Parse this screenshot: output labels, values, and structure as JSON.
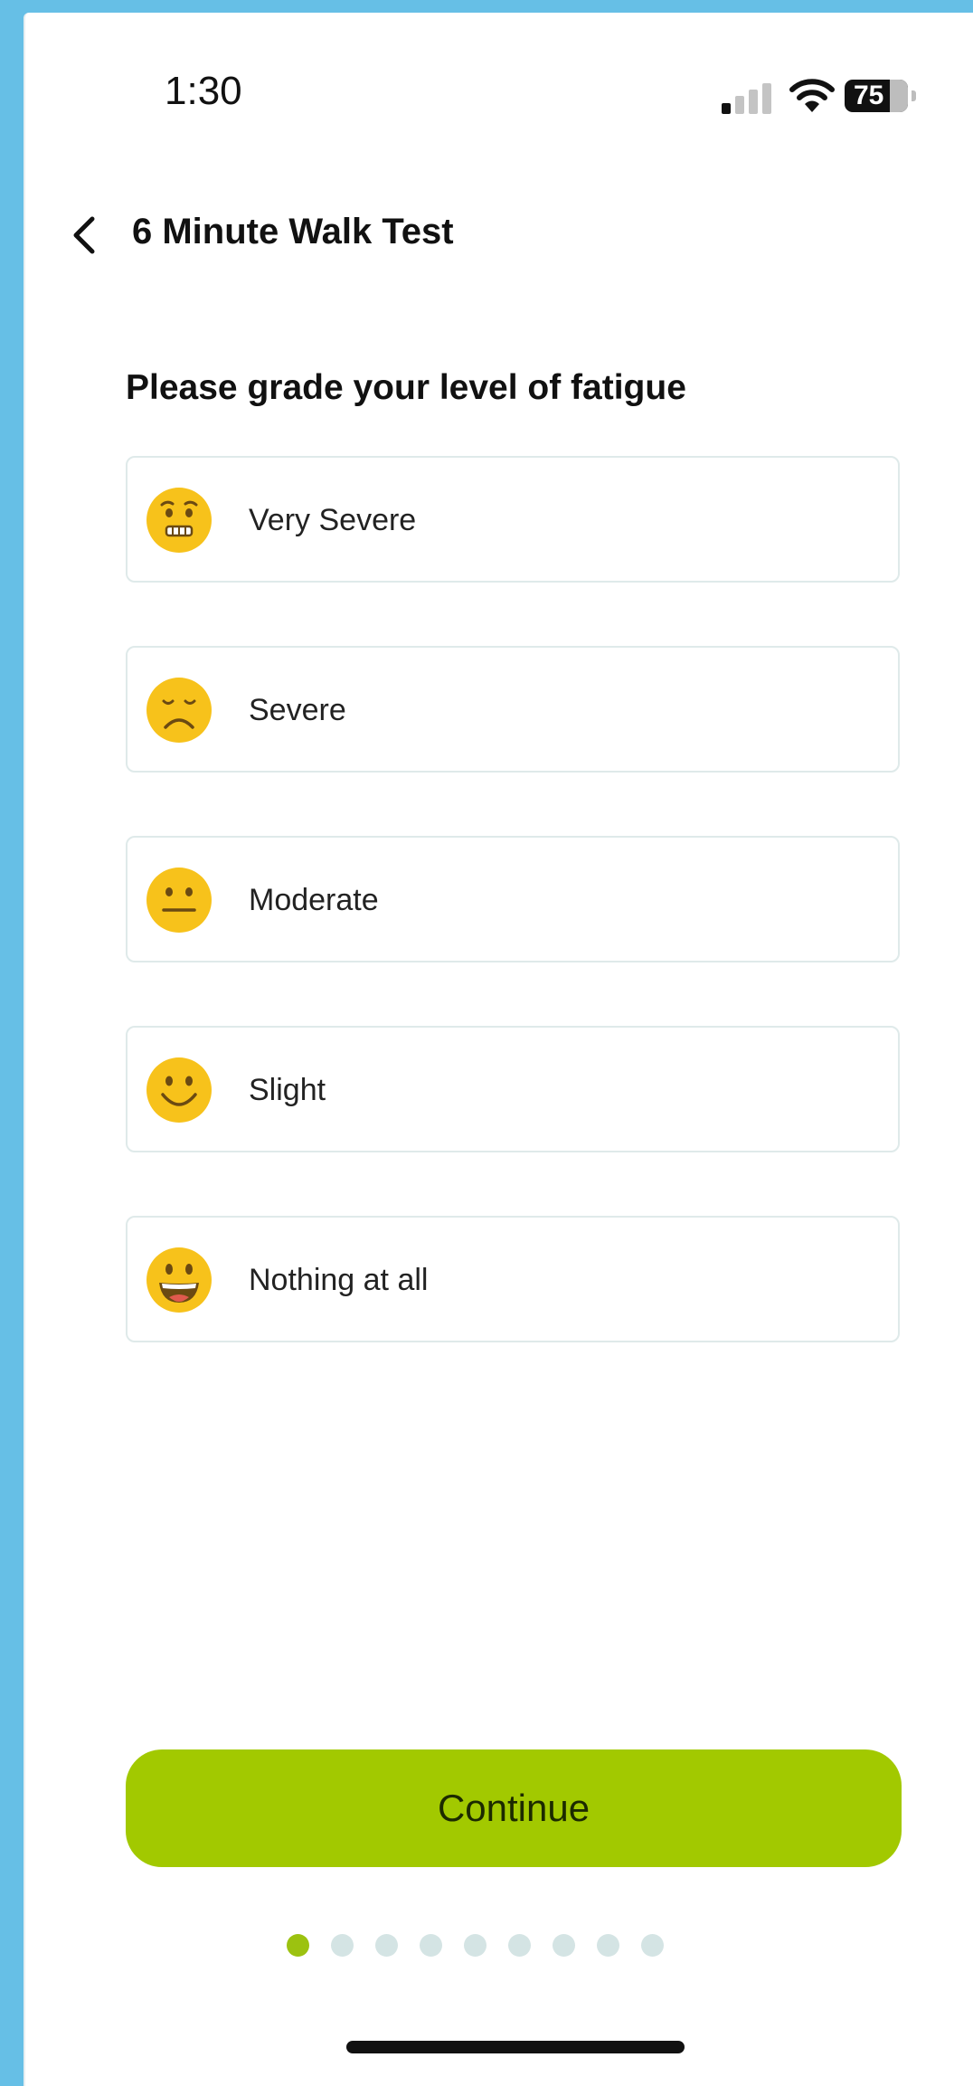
{
  "status_bar": {
    "time": "1:30",
    "battery_percent": "75",
    "signal_icon": "cellular-signal-icon",
    "wifi_icon": "wifi-icon",
    "battery_icon": "battery-icon"
  },
  "header": {
    "title": "6 Minute Walk Test",
    "back_icon": "chevron-left-icon"
  },
  "question": "Please grade your level of fatigue",
  "options": [
    {
      "label": "Very Severe",
      "icon": "pleading-face-icon"
    },
    {
      "label": "Severe",
      "icon": "frowning-face-icon"
    },
    {
      "label": "Moderate",
      "icon": "neutral-face-icon"
    },
    {
      "label": "Slight",
      "icon": "slightly-smiling-face-icon"
    },
    {
      "label": "Nothing at all",
      "icon": "grinning-face-icon"
    }
  ],
  "continue_label": "Continue",
  "pagination": {
    "total": 9,
    "current": 1
  },
  "colors": {
    "accent": "#a2c900",
    "dot_active": "#9cc210",
    "dot_inactive": "#d4e4e4",
    "option_border": "#dfeaea",
    "emoji_fill": "#f7c21b",
    "background_frame": "#66bfe6"
  }
}
